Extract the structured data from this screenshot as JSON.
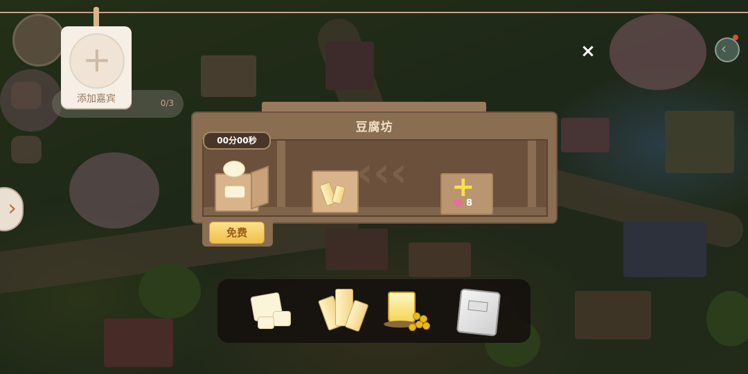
{
  "guest": {
    "label": "添加嘉宾",
    "plus": "+"
  },
  "hud": {
    "progress_text": "0/3",
    "left_tab_arrow": "›",
    "right_button_glyph": "‹"
  },
  "close": {
    "label": "×"
  },
  "workshop": {
    "title": "豆腐坊",
    "timer": "00分00秒",
    "free_button": "免费",
    "unlock_cost": "8",
    "unlock_plus": "+",
    "chevrons": "‹‹‹"
  },
  "tray": {
    "items": [
      {
        "icon": "tofu-icon"
      },
      {
        "icon": "soy-milk-bottle-icon"
      },
      {
        "icon": "soy-drink-icon"
      },
      {
        "icon": "flour-bag-icon"
      }
    ]
  },
  "colors": {
    "shelf": "#8a6e52",
    "button": "#f0c04a",
    "tray": "#14100c",
    "gem": "#ec6aa0"
  }
}
